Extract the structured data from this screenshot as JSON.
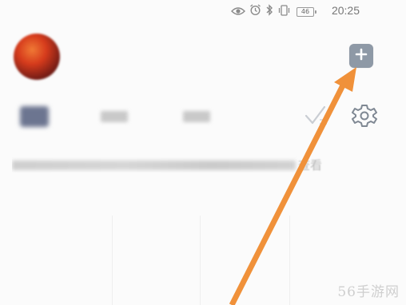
{
  "status_bar": {
    "carrier": "",
    "battery_level": "46",
    "time": "20:25",
    "icons": [
      "eye-icon",
      "alarm-icon",
      "bluetooth-icon",
      "vibrate-icon",
      "battery-icon"
    ]
  },
  "header": {
    "avatar_icon": "avatar",
    "add_button_icon": "plus-icon"
  },
  "tabs": [
    {
      "label": ""
    },
    {
      "label": ""
    },
    {
      "label": ""
    }
  ],
  "toolbar": {
    "icons": [
      "check-icon",
      "gear-icon"
    ]
  },
  "info_line": {
    "visible_text": "查看"
  },
  "annotation": {
    "arrow_color": "#f0913a"
  },
  "watermark": {
    "text": "56手游网"
  }
}
